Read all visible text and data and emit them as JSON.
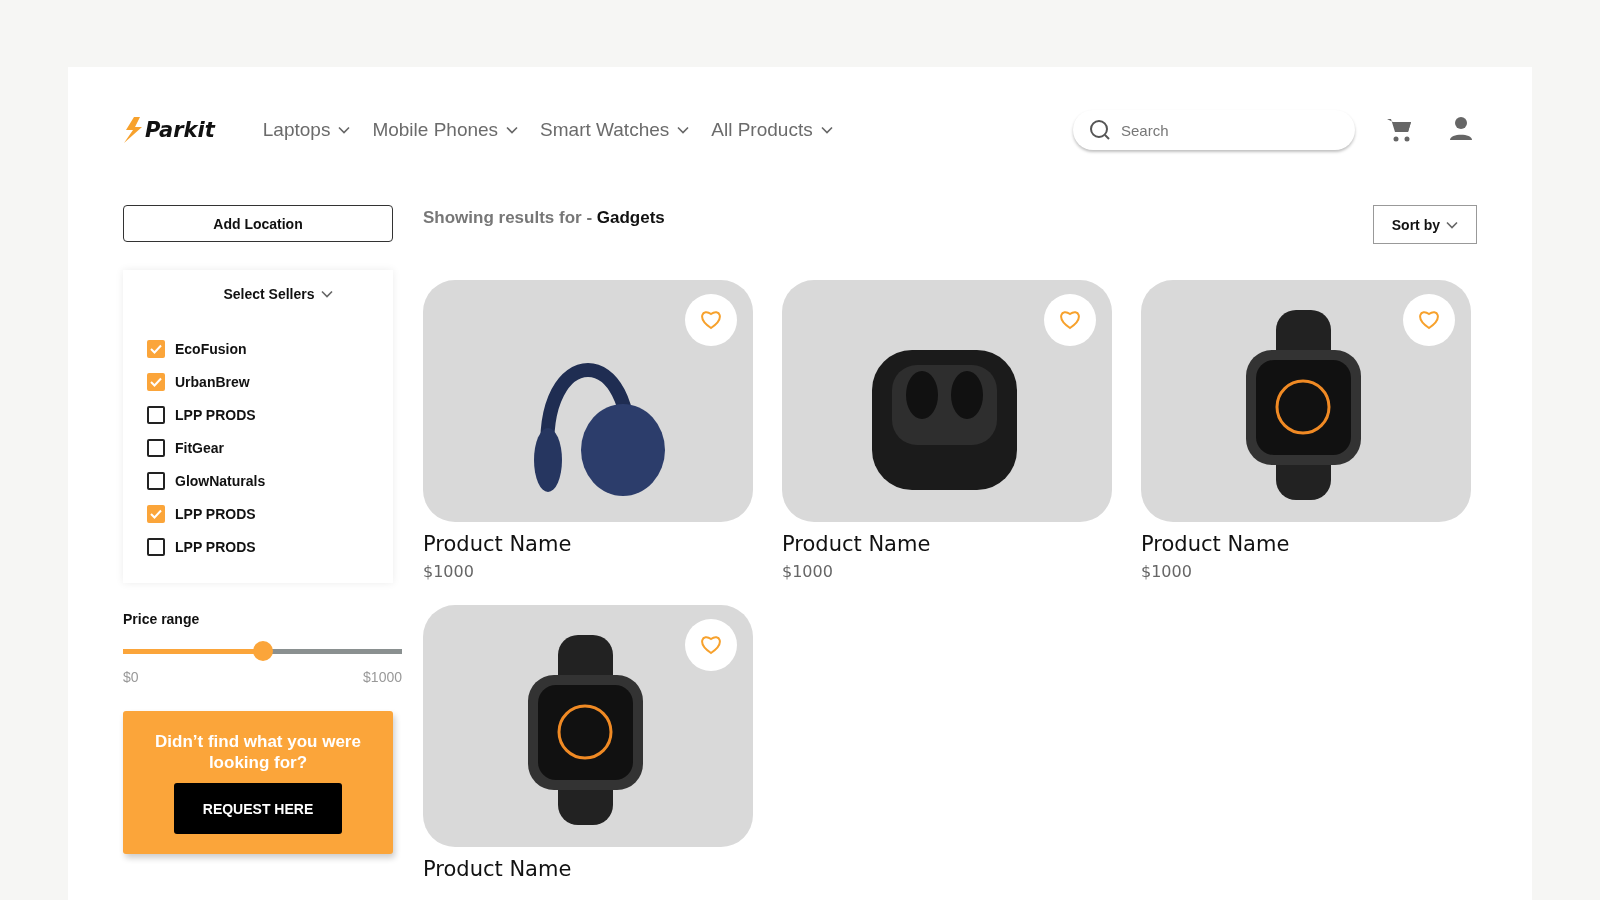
{
  "header": {
    "logo": "Parkit",
    "nav": [
      {
        "label": "Laptops"
      },
      {
        "label": "Mobile Phones"
      },
      {
        "label": "Smart Watches"
      },
      {
        "label": "All Products"
      }
    ],
    "search": {
      "placeholder": "Search"
    }
  },
  "sidebar": {
    "add_location": "Add Location",
    "sellers_title": "Select Sellers",
    "sellers": [
      {
        "label": "EcoFusion",
        "checked": true
      },
      {
        "label": "UrbanBrew",
        "checked": true
      },
      {
        "label": "LPP PRODS",
        "checked": false
      },
      {
        "label": "FitGear",
        "checked": false
      },
      {
        "label": "GlowNaturals",
        "checked": false
      },
      {
        "label": "LPP PRODS",
        "checked": true
      },
      {
        "label": "LPP PRODS",
        "checked": false
      }
    ],
    "price_range": {
      "label": "Price range",
      "level": 0.5,
      "min": "$0",
      "max": "$1000"
    },
    "request": {
      "text": "Didn’t find what you were looking for?",
      "button": "REQUEST HERE"
    }
  },
  "results": {
    "prefix": "Showing results for - ",
    "query": "Gadgets",
    "sort": "Sort by"
  },
  "products": [
    {
      "kind": "headphones",
      "name": "Product Name",
      "price": "$1000"
    },
    {
      "kind": "earbuds",
      "name": "Product Name",
      "price": "$1000"
    },
    {
      "kind": "watch",
      "name": "Product Name",
      "price": "$1000"
    },
    {
      "kind": "watch",
      "name": "Product Name"
    }
  ]
}
